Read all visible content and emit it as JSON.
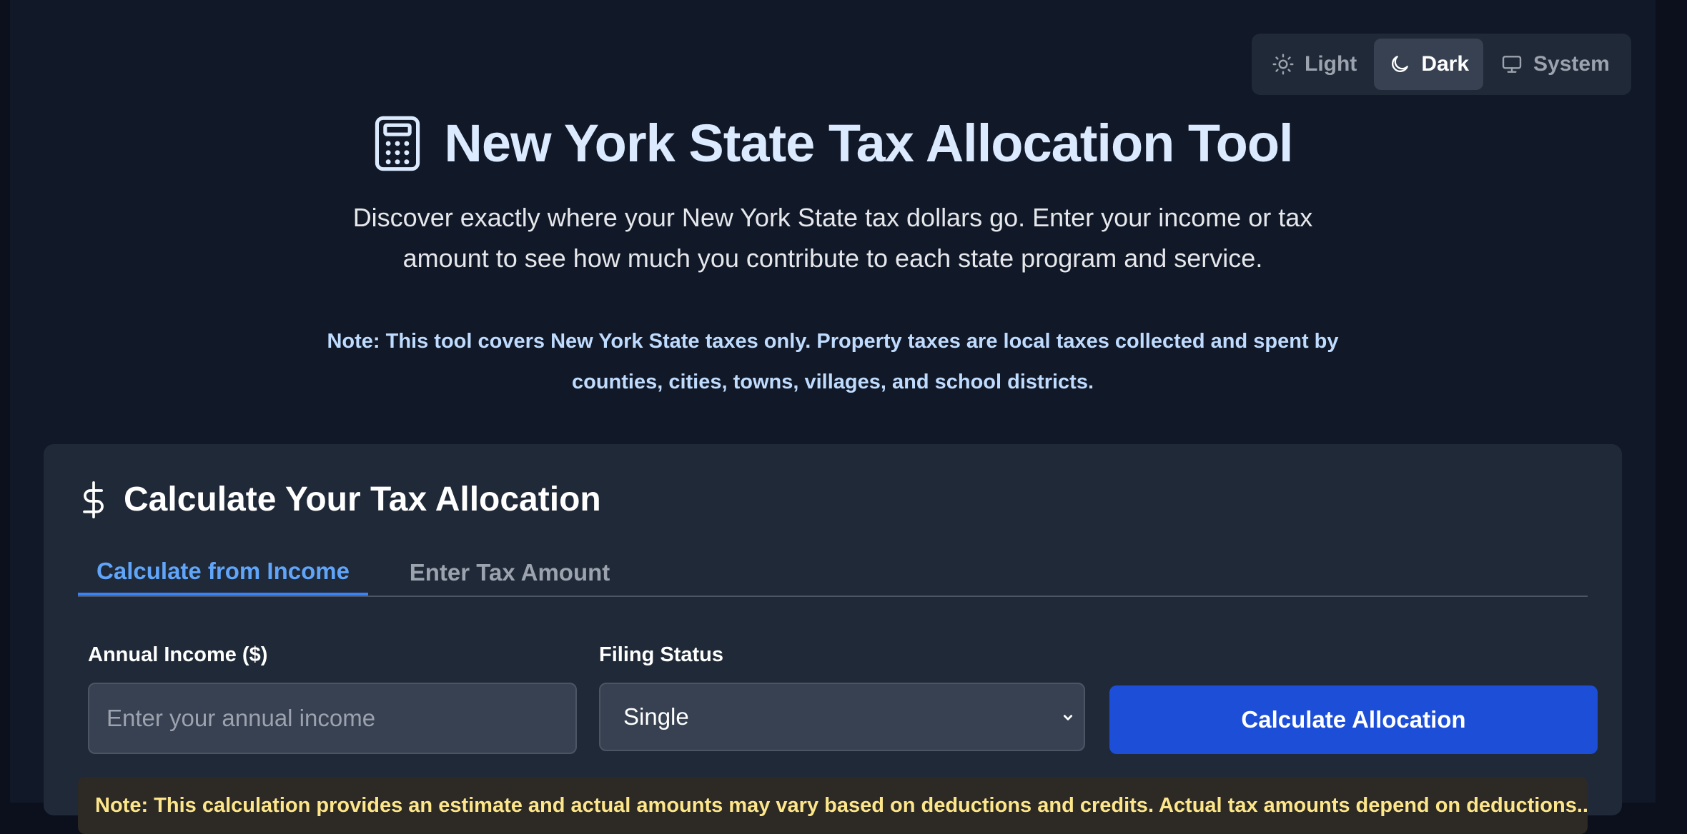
{
  "theme_toggle": {
    "options": [
      {
        "label": "Light",
        "icon": "sun-icon"
      },
      {
        "label": "Dark",
        "icon": "moon-icon"
      },
      {
        "label": "System",
        "icon": "monitor-icon"
      }
    ],
    "selected": "Dark"
  },
  "header": {
    "title": "New York State Tax Allocation Tool",
    "icon": "calculator-icon",
    "subtitle": "Discover exactly where your New York State tax dollars go. Enter your income or tax amount to see how much you contribute to each state program and service.",
    "note": "Note: This tool covers New York State taxes only. Property taxes are local taxes collected and spent by counties, cities, towns, villages, and school districts."
  },
  "calculator": {
    "title": "Calculate Your Tax Allocation",
    "icon": "dollar-icon",
    "tabs": [
      {
        "label": "Calculate from Income",
        "active": true
      },
      {
        "label": "Enter Tax Amount",
        "active": false
      }
    ],
    "income_label": "Annual Income ($)",
    "income_placeholder": "Enter your annual income",
    "income_value": "",
    "filing_label": "Filing Status",
    "filing_value": "Single",
    "submit_label": "Calculate Allocation",
    "warning_text": "Note: This calculation provides an estimate and actual amounts may vary based on deductions and credits. Actual tax amounts depend on deductions..."
  },
  "colors": {
    "background": "#111827",
    "card": "#1f2937",
    "accent": "#1d4ed8",
    "tab_active": "#60a5fa",
    "title": "#dbeafe",
    "note": "#bfdbfe"
  }
}
